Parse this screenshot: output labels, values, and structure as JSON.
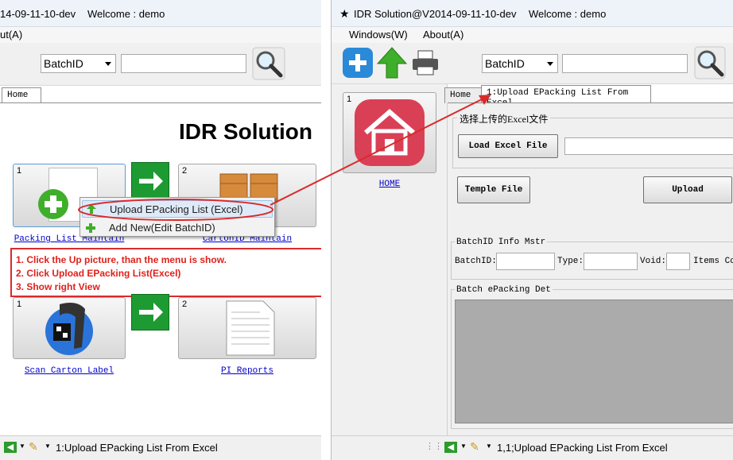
{
  "left": {
    "title": "14-09-11-10-dev",
    "welcome": "Welcome : demo",
    "menu_item": "ut(A)",
    "search_select": "BatchID",
    "home_tab": "Home",
    "heading": "IDR Solution",
    "tiles": [
      {
        "num": "1",
        "label": "Packing List Maintain"
      },
      {
        "num": "2",
        "label": "CartonID Maintain"
      },
      {
        "num": "1",
        "label": "Scan Carton Label"
      },
      {
        "num": "2",
        "label": "PI Reports"
      }
    ],
    "context_menu": {
      "items": [
        "Upload EPacking List (Excel)",
        "Add New(Edit BatchID)"
      ]
    },
    "notes": [
      "1. Click the Up picture, than the menu is show.",
      "2. Click Upload EPacking List(Excel)",
      "3. Show right View"
    ],
    "status": "1:Upload EPacking List From Excel"
  },
  "right": {
    "title": "IDR Solution@V2014-09-11-10-dev",
    "welcome": "Welcome : demo",
    "menus": [
      "Windows(W)",
      "About(A)"
    ],
    "search_select": "BatchID",
    "side_tile_num": "1",
    "side_link": "HOME",
    "tabs": [
      "Home",
      "1:Upload EPacking List From Excel"
    ],
    "upload_group_title": "选择上传的Excel文件",
    "load_button": "Load Excel File",
    "temple_button": "Temple File",
    "upload_button": "Upload",
    "batch_info_title": "BatchID Info Mstr",
    "fields": [
      "BatchID:",
      "Type:",
      "Void:",
      "Items Co"
    ],
    "batch_det_title": "Batch ePacking Det",
    "status": "1,1;Upload EPacking List From Excel"
  },
  "colors": {
    "accent_red": "#e0201a",
    "green": "#1e9a33",
    "home_tile_red": "#d94056"
  }
}
